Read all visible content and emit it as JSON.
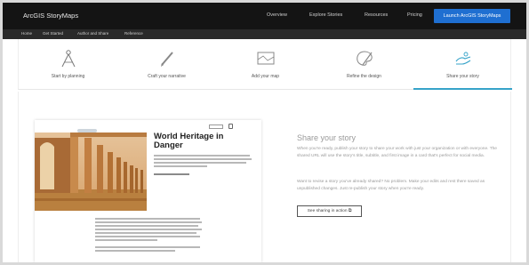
{
  "topbar": {
    "brand": "ArcGIS StoryMaps",
    "nav": [
      "Overview",
      "Explore Stories",
      "Resources",
      "Pricing"
    ],
    "launch_label": "Launch ArcGIS StoryMaps"
  },
  "subbar": {
    "links": [
      "Home",
      "Get Started",
      "Author and Share",
      "Reference"
    ]
  },
  "steps": [
    {
      "label": "Start by planning",
      "icon": "compass-icon"
    },
    {
      "label": "Craft your narrative",
      "icon": "pencil-icon"
    },
    {
      "label": "Add your map",
      "icon": "map-icon"
    },
    {
      "label": "Refine the design",
      "icon": "palette-icon"
    },
    {
      "label": "Share your story",
      "icon": "share-hands-icon",
      "active": true
    }
  ],
  "preview": {
    "title": "World Heritage in Danger"
  },
  "share": {
    "heading": "Share your story",
    "para1": "When you're ready, publish your story to share your work with just your organization or with everyone. The shared URL will use the story's title, subtitle, and first image in a card that's perfect for social media.",
    "para2": "Want to revise a story you've already shared? No problem. Make your edits and rest there saved as unpublished changes. Just re-publish your story when you're ready.",
    "button": "See sharing in action"
  },
  "colors": {
    "accent": "#36a3c9",
    "launch": "#1f6fd1",
    "topbar": "#141414"
  }
}
